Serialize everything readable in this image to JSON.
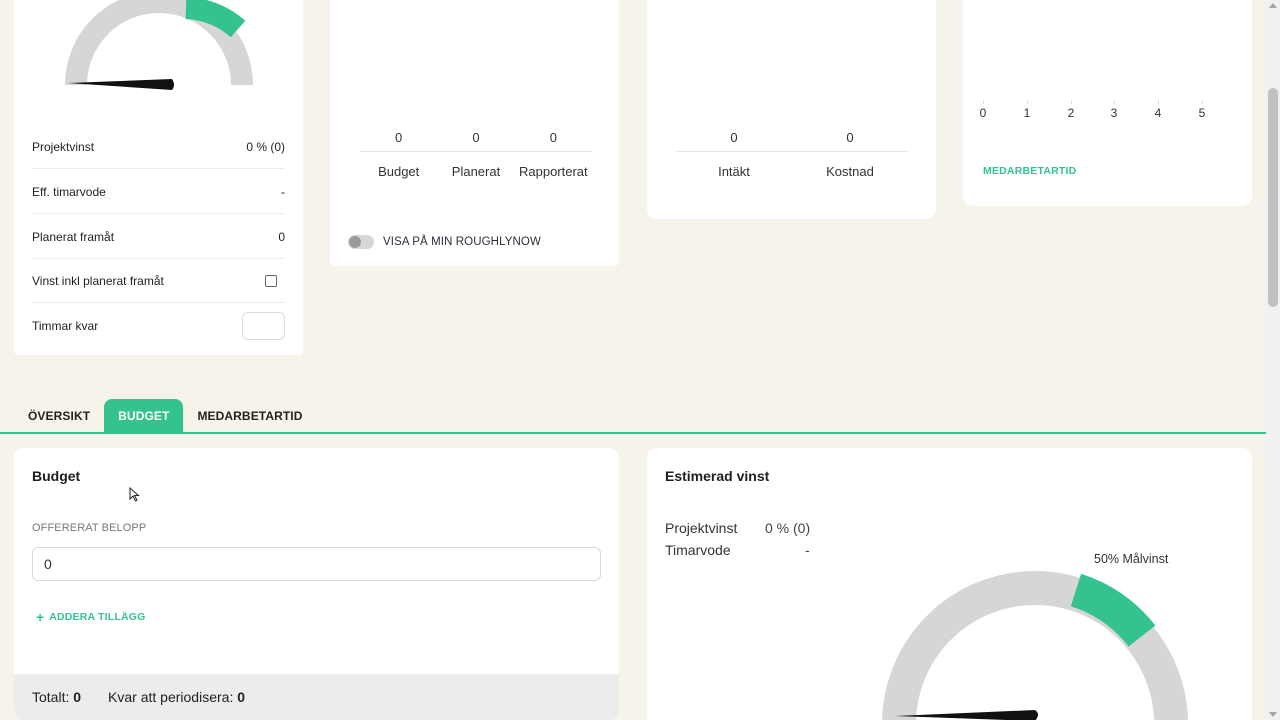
{
  "colors": {
    "accent": "#34c38f",
    "gauge_track": "#d6d6d6",
    "background": "#f6f4ea"
  },
  "left_card": {
    "gauge": {
      "needle_value_pct": 0,
      "target_start_pct": 0.5,
      "target_end_pct": 0.8
    },
    "rows": [
      {
        "label": "Projektvinst",
        "value": "0 % (0)"
      },
      {
        "label": "Eff. timarvode",
        "value": "-"
      },
      {
        "label": "Planerat framåt",
        "value": "0"
      },
      {
        "label": "Vinst inkl planerat framåt",
        "checked": false
      },
      {
        "label": "Timmar kvar",
        "value": ""
      }
    ]
  },
  "hours_card": {
    "columns": [
      {
        "value": "0",
        "label": "Budget"
      },
      {
        "value": "0",
        "label": "Planerat"
      },
      {
        "value": "0",
        "label": "Rapporterat"
      }
    ],
    "toggle_label": "VISA PÅ MIN ROUGHLYNOW",
    "toggle_on": false
  },
  "money_card": {
    "columns": [
      {
        "value": "0",
        "label": "Intäkt"
      },
      {
        "value": "0",
        "label": "Kostnad"
      }
    ]
  },
  "staff_card": {
    "axis_ticks": [
      "0",
      "1",
      "2",
      "3",
      "4",
      "5"
    ],
    "link_label": "MEDARBETARTID"
  },
  "tabs": [
    {
      "label": "ÖVERSIKT",
      "active": false
    },
    {
      "label": "BUDGET",
      "active": true
    },
    {
      "label": "MEDARBETARTID",
      "active": false
    }
  ],
  "budget": {
    "title": "Budget",
    "field_label": "OFFERERAT BELOPP",
    "amount_value": "0",
    "add_label": "ADDERA TILLÄGG",
    "total_label": "Totalt:",
    "total_value": "0",
    "remaining_label": "Kvar att periodisera:",
    "remaining_value": "0"
  },
  "estimate": {
    "title": "Estimerad vinst",
    "profit_label": "Projektvinst",
    "profit_value": "0 % (0)",
    "rate_label": "Timarvode",
    "rate_value": "-",
    "target_label": "50% Målvinst",
    "gauge": {
      "needle_value_pct": 0,
      "target_start_pct": 0.5,
      "target_end_pct": 0.8
    }
  }
}
